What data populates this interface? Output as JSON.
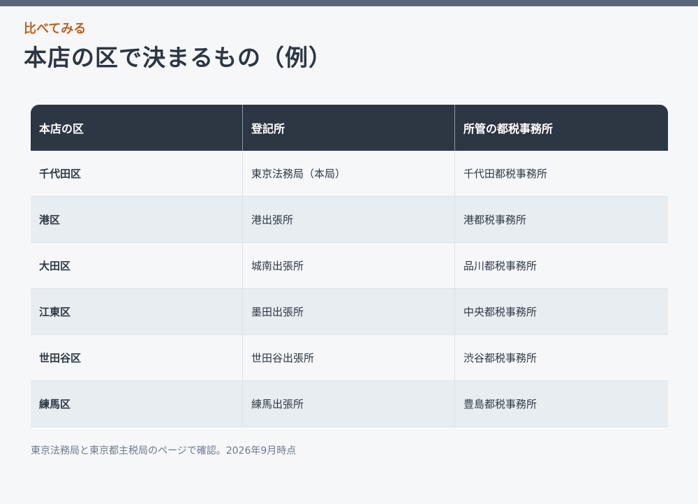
{
  "header": {
    "eyebrow": "比べてみる",
    "title": "本店の区で決まるもの（例）"
  },
  "table": {
    "columns": [
      "本店の区",
      "登記所",
      "所管の都税事務所"
    ],
    "rows": [
      {
        "ward": "千代田区",
        "registry": "東京法務局（本局）",
        "tax_office": "千代田都税事務所"
      },
      {
        "ward": "港区",
        "registry": "港出張所",
        "tax_office": "港都税事務所"
      },
      {
        "ward": "大田区",
        "registry": "城南出張所",
        "tax_office": "品川都税事務所"
      },
      {
        "ward": "江東区",
        "registry": "墨田出張所",
        "tax_office": "中央都税事務所"
      },
      {
        "ward": "世田谷区",
        "registry": "世田谷出張所",
        "tax_office": "渋谷都税事務所"
      },
      {
        "ward": "練馬区",
        "registry": "練馬出張所",
        "tax_office": "豊島都税事務所"
      }
    ]
  },
  "footnote": "東京法務局と東京都主税局のページで確認。2026年9月時点",
  "colors": {
    "accent_bar": "#56677b",
    "eyebrow": "#c0621f",
    "header_bg": "#2d3743",
    "row_alt": "#e8edf1",
    "background": "#f5f7f9"
  }
}
